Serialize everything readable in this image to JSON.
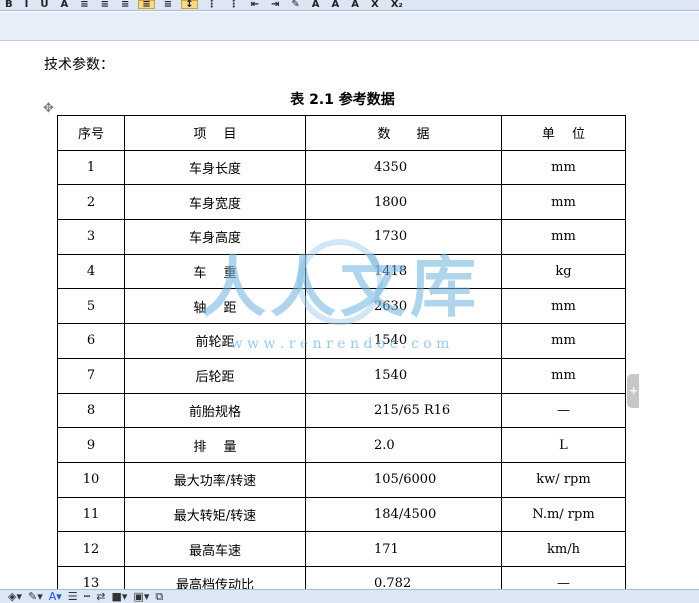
{
  "toolbar": {
    "items": [
      {
        "name": "bold-button",
        "label": "B"
      },
      {
        "name": "italic-button",
        "label": "I"
      },
      {
        "name": "underline-button",
        "label": "U"
      },
      {
        "name": "font-color-button",
        "label": "A"
      },
      {
        "name": "align-left-button",
        "label": "≡"
      },
      {
        "name": "align-center-button",
        "label": "≡"
      },
      {
        "name": "align-right-button",
        "label": "≡"
      },
      {
        "name": "justify-button",
        "label": "≡"
      },
      {
        "name": "distributed-button",
        "label": "≡"
      },
      {
        "name": "line-spacing-button",
        "label": "↕"
      },
      {
        "name": "numbering-button",
        "label": "⋮"
      },
      {
        "name": "bullets-button",
        "label": "⋮"
      },
      {
        "name": "decrease-indent-button",
        "label": "⇤"
      },
      {
        "name": "increase-indent-button",
        "label": "⇥"
      },
      {
        "name": "highlight-button",
        "label": "✎"
      },
      {
        "name": "font-color2-button",
        "label": "A"
      },
      {
        "name": "grow-font-button",
        "label": "A"
      },
      {
        "name": "shrink-font-button",
        "label": "A"
      },
      {
        "name": "superscript-button",
        "label": "X"
      },
      {
        "name": "subscript-button",
        "label": "X₂"
      }
    ]
  },
  "document": {
    "intro": "技术参数：",
    "caption_prefix": "表 ",
    "caption_number": "2.1",
    "caption_title": " 参考数据",
    "headers": [
      "序号",
      "项　 目",
      "数　　据",
      "单　 位"
    ],
    "rows": [
      [
        "1",
        "车身长度",
        "4350",
        "mm"
      ],
      [
        "2",
        "车身宽度",
        "1800",
        "mm"
      ],
      [
        "3",
        "车身高度",
        "1730",
        "mm"
      ],
      [
        "4",
        "车　 重",
        "1418",
        "kg"
      ],
      [
        "5",
        "轴　 距",
        "2630",
        "mm"
      ],
      [
        "6",
        "前轮距",
        "1540",
        "mm"
      ],
      [
        "7",
        "后轮距",
        "1540",
        "mm"
      ],
      [
        "8",
        "前胎规格",
        "215/65 R16",
        "—"
      ],
      [
        "9",
        "排　 量",
        "2.0",
        "L"
      ],
      [
        "10",
        "最大功率/转速",
        "105/6000",
        "kw/ rpm"
      ],
      [
        "11",
        "最大转矩/转速",
        "184/4500",
        "N.m/ rpm"
      ],
      [
        "12",
        "最高车速",
        "171",
        "km/h"
      ],
      [
        "13",
        "最高档传动比",
        "0.782",
        "—"
      ]
    ]
  },
  "watermark": {
    "text": "人人文库",
    "url": "w w w . r e n r e n d o c . c o m",
    "color": "#6fb3df"
  },
  "colors": {
    "toolbar_bg": "#dce6f4",
    "active_button": "#f7d98b"
  }
}
